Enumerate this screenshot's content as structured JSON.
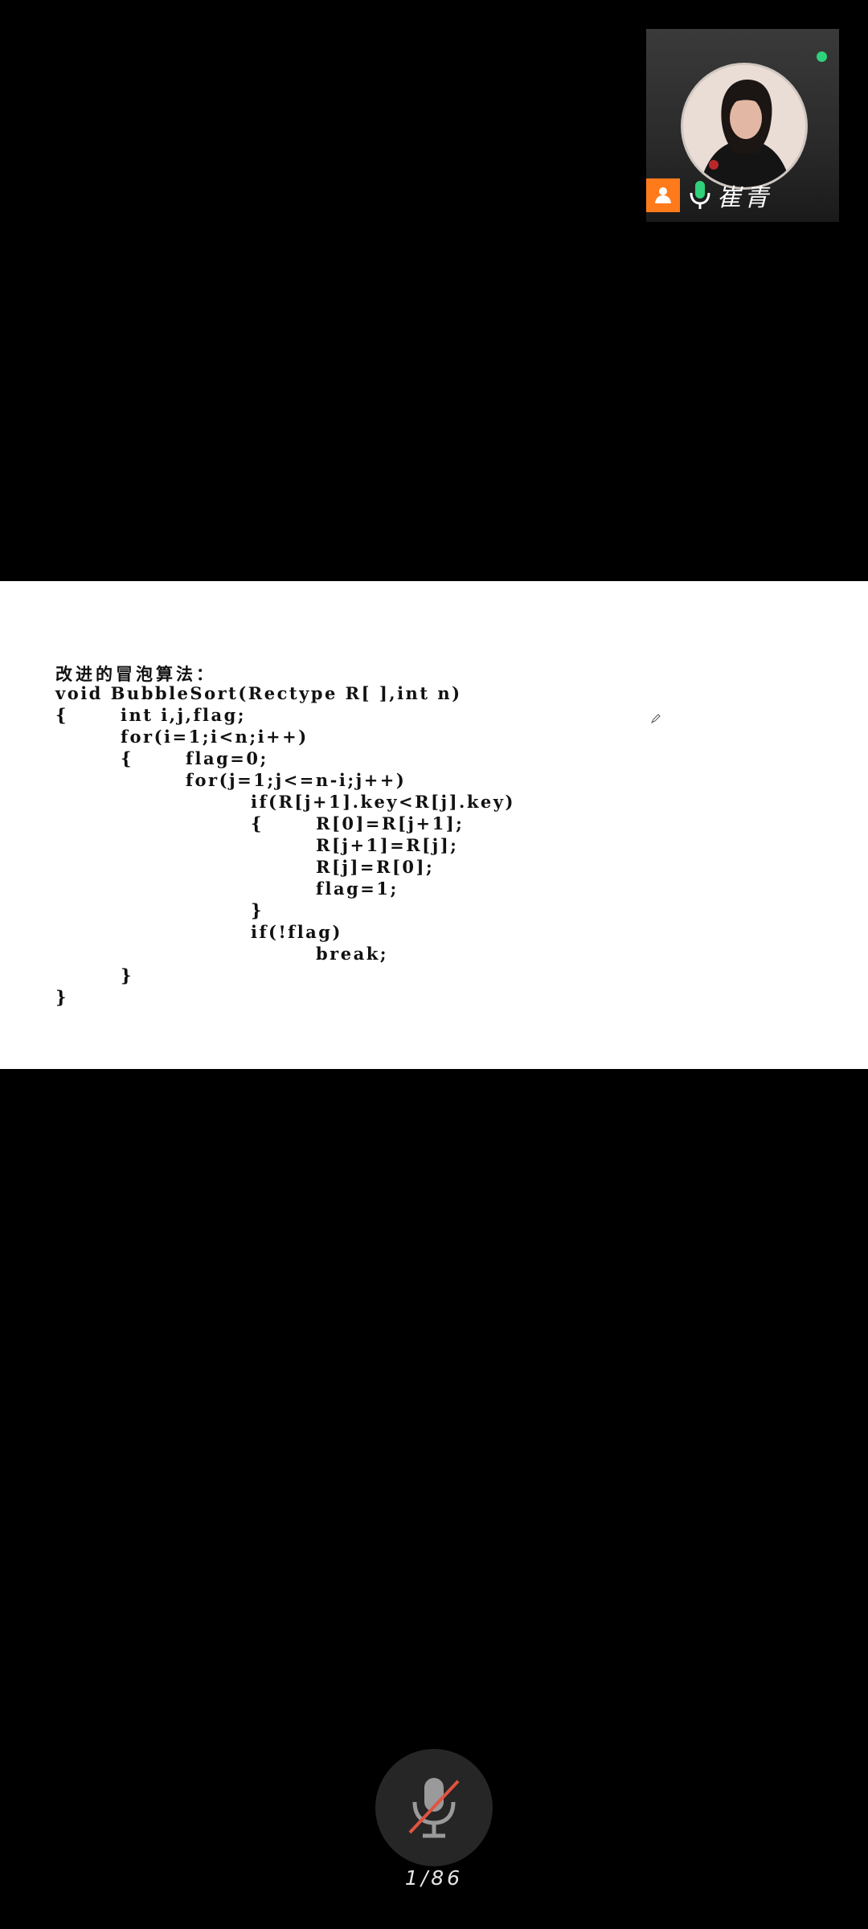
{
  "speaker": {
    "name": "崔青",
    "online_color": "#2fd27a",
    "badge_icon": "user-icon",
    "mic_icon": "microphone-active-icon"
  },
  "slide": {
    "heading": "改进的冒泡算法：",
    "code": [
      "void BubbleSort(Rectype R[ ],int n)",
      "{\tint i,j,flag;",
      "\tfor(i=1;i<n;i++)",
      "\t{\tflag=0;",
      "\t\tfor(j=1;j<=n-i;j++)",
      "\t\t\tif(R[j+1].key<R[j].key)",
      "\t\t\t{\tR[0]=R[j+1];",
      "\t\t\t\tR[j+1]=R[j];",
      "\t\t\t\tR[j]=R[0];",
      "\t\t\t\tflag=1;",
      "\t\t\t}",
      "\t\t\tif(!flag)",
      "\t\t\t\tbreak;",
      "\t}",
      "}"
    ]
  },
  "controls": {
    "mic_button_icon": "microphone-muted-icon",
    "page_indicator": "1/86"
  }
}
